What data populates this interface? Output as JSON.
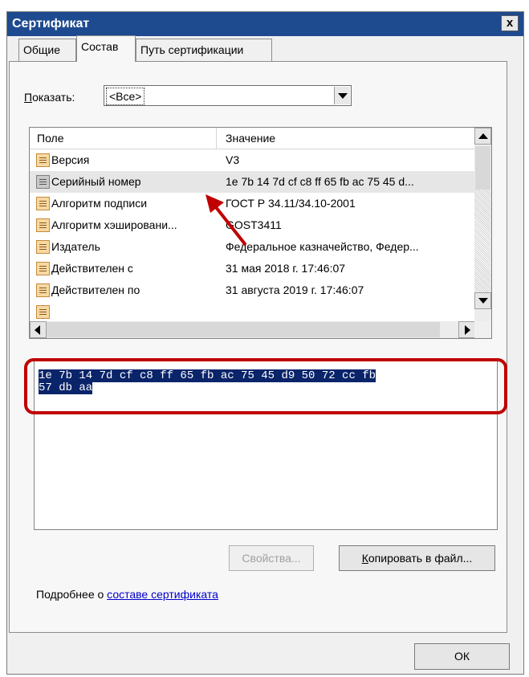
{
  "window": {
    "title": "Сертификат",
    "close_label": "x"
  },
  "tabs": [
    {
      "label": "Общие",
      "active": false
    },
    {
      "label": "Состав",
      "active": true
    },
    {
      "label": "Путь сертификации",
      "active": false
    }
  ],
  "show": {
    "label_hotkey": "П",
    "label_rest": "оказать:",
    "value": "<Все>"
  },
  "list": {
    "columns": [
      "Поле",
      "Значение"
    ],
    "rows": [
      {
        "field": "Версия",
        "value": "V3"
      },
      {
        "field": "Серийный номер",
        "value": "1e 7b 14 7d cf c8 ff 65 fb ac 75 45 d...",
        "selected": true
      },
      {
        "field": "Алгоритм подписи",
        "value": "ГОСТ Р 34.11/34.10-2001"
      },
      {
        "field": "Алгоритм хэшировани...",
        "value": "GOST3411"
      },
      {
        "field": "Издатель",
        "value": "Федеральное казначейство, Федер..."
      },
      {
        "field": "Действителен с",
        "value": "31 мая 2018 г. 17:46:07"
      },
      {
        "field": "Действителен по",
        "value": "31 августа 2019 г. 17:46:07"
      }
    ]
  },
  "detail": {
    "line1": " 1e 7b 14 7d cf c8 ff 65 fb ac 75 45 d9 50 72 cc fb",
    "line2": "57 db aa"
  },
  "buttons": {
    "properties": "Свойства...",
    "copy_hotkey": "К",
    "copy_rest": "опировать в файл...",
    "ok": "ОК"
  },
  "footer": {
    "text": "Подробнее о ",
    "link": "составе сертификата"
  },
  "colors": {
    "title_bar": "#1e4a8f",
    "selection": "#0a246a",
    "annotation": "#c00000",
    "link": "#0000cc"
  }
}
